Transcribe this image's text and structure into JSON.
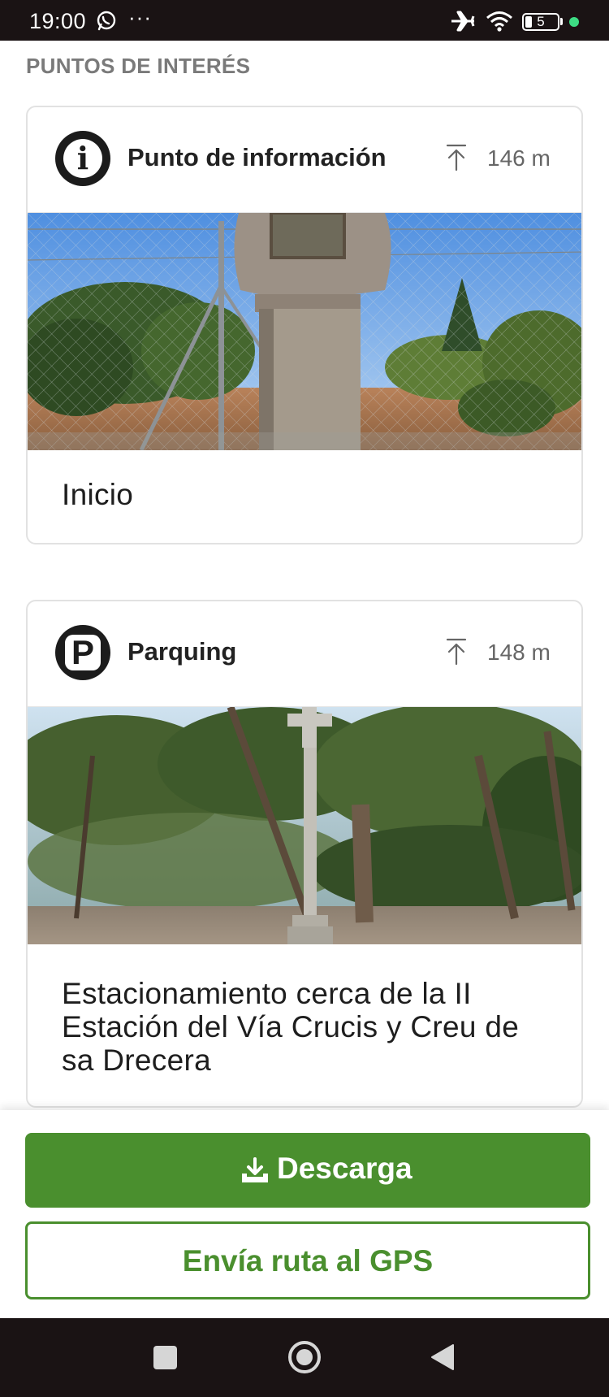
{
  "status_bar": {
    "time": "19:00",
    "notification_icons": [
      "whatsapp-icon",
      "more-dots-icon"
    ],
    "overflow_dots": "···",
    "system_icons": [
      "airplane-icon",
      "wifi-icon",
      "battery-icon"
    ],
    "battery_level": "5",
    "indicator_color": "#3ddc84"
  },
  "section": {
    "title": "PUNTOS DE INTERÉS"
  },
  "points_of_interest": [
    {
      "type": "Punto de información",
      "icon": "info-icon",
      "elevation": "146 m",
      "elevation_icon": "arrow-up-to-line-icon",
      "image": "stone-cross-monument-photo",
      "caption": "Inicio"
    },
    {
      "type": "Parquing",
      "icon": "parking-icon",
      "elevation": "148 m",
      "elevation_icon": "arrow-up-to-line-icon",
      "image": "pine-forest-cross-photo",
      "caption": "Estacionamiento cerca de la II Estación del Vía Crucis y Creu de sa Drecera"
    }
  ],
  "actions": {
    "download_label": "Descarga",
    "download_icon": "download-tray-icon",
    "send_gps_label": "Envía ruta al GPS",
    "accent_color": "#4a8f2e"
  },
  "navigation_bar": {
    "buttons": [
      "recents-square-icon",
      "home-circle-icon",
      "back-triangle-icon"
    ]
  }
}
